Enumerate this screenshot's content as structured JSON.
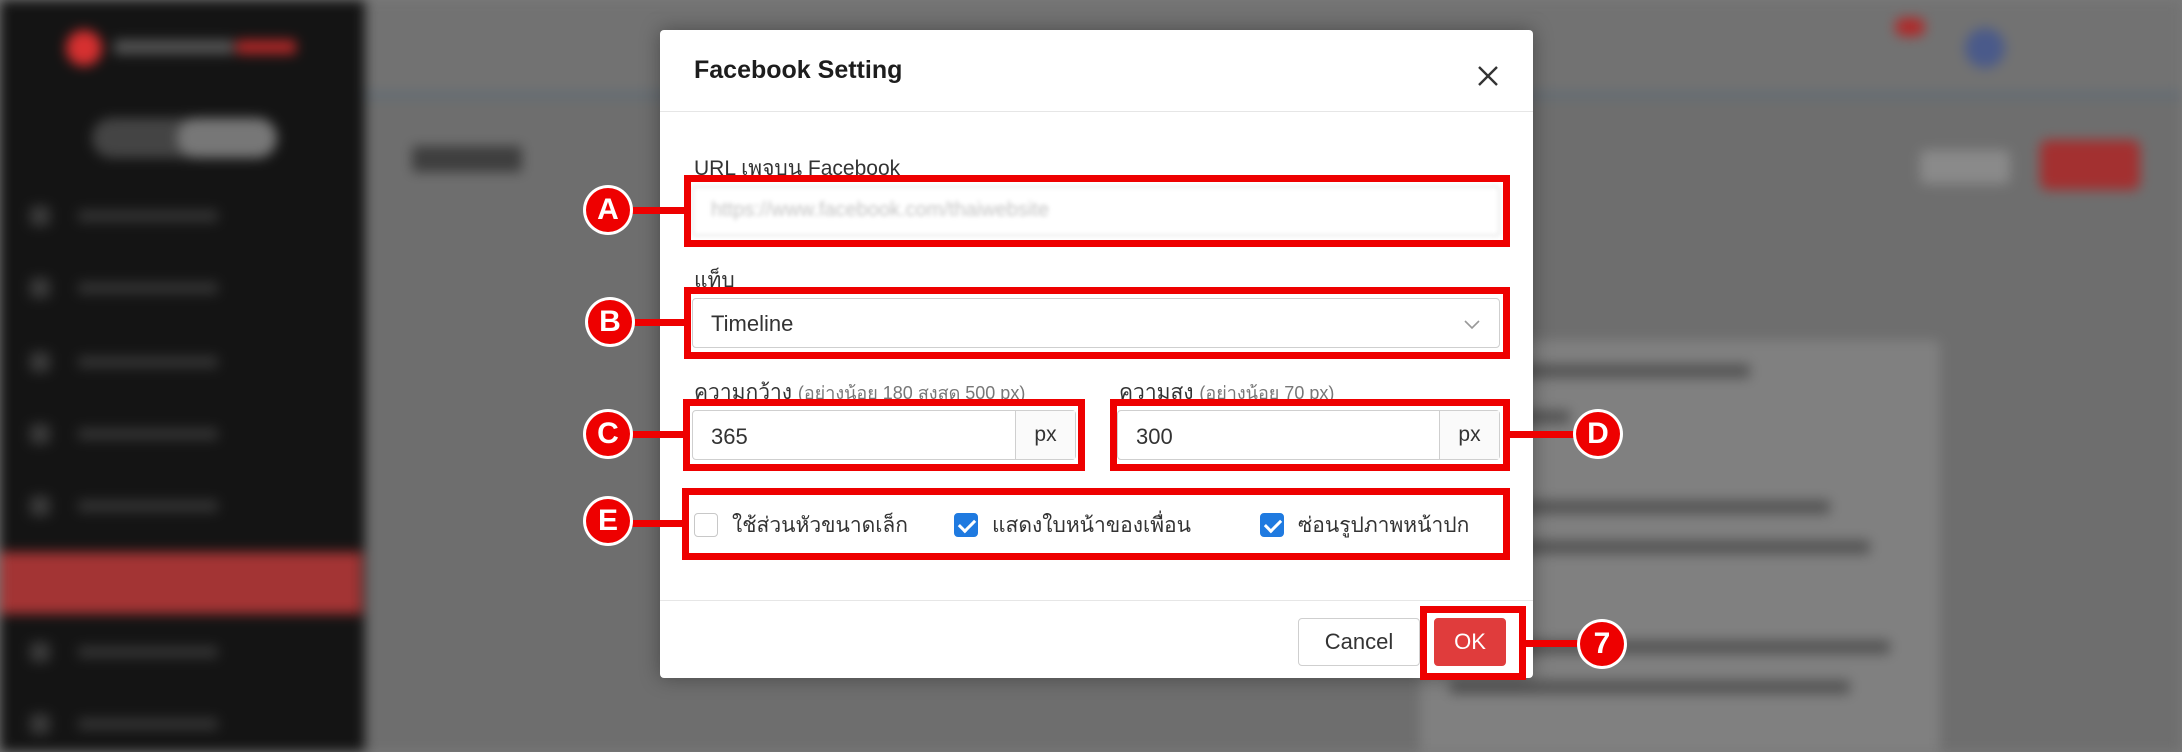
{
  "modal": {
    "title": "Facebook Setting",
    "url_label": "URL เพจบน Facebook",
    "url_value": "https://www.facebook.com/thaiwebsite",
    "tab_label": "แท็บ",
    "tab_value": "Timeline",
    "width_label": "ความกว้าง",
    "width_hint": "(อย่างน้อย 180 สูงสุด 500 px)",
    "width_value": "365",
    "width_unit": "px",
    "height_label": "ความสูง",
    "height_hint": "(อย่างน้อย 70 px)",
    "height_value": "300",
    "height_unit": "px",
    "checkboxes": [
      {
        "label": "ใช้ส่วนหัวขนาดเล็ก",
        "checked": false
      },
      {
        "label": "แสดงใบหน้าของเพื่อน",
        "checked": true
      },
      {
        "label": "ซ่อนรูปภาพหน้าปก",
        "checked": true
      }
    ],
    "cancel_label": "Cancel",
    "ok_label": "OK"
  },
  "annotations": {
    "markers": [
      "A",
      "B",
      "C",
      "D",
      "E",
      "7"
    ],
    "color": "#ee0000"
  },
  "colors": {
    "accent_ok": "#e03c3c",
    "checkbox_checked": "#1f7ae0",
    "sidebar_bg": "#141414"
  },
  "icons": {
    "close": "close-icon",
    "chevron": "chevron-down-icon",
    "check": "checkmark-icon"
  }
}
